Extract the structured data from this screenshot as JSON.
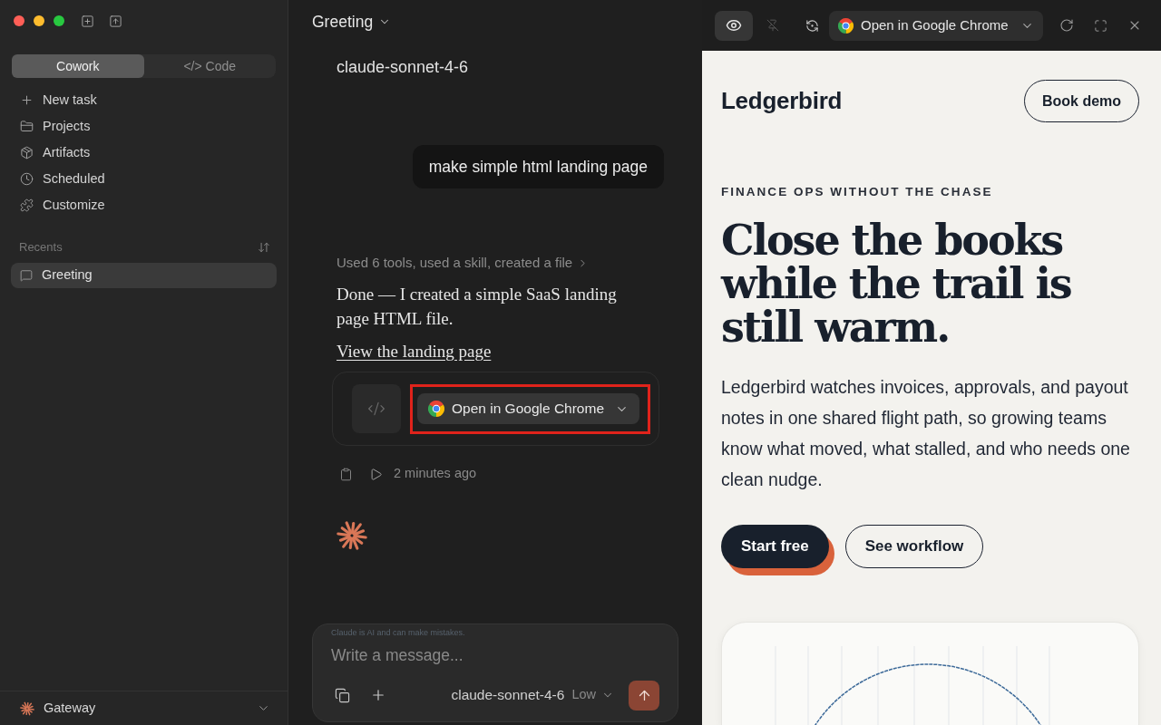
{
  "sidebar": {
    "mode_tabs": [
      {
        "label": "Cowork",
        "selected": true
      },
      {
        "label": "</> Code",
        "selected": false
      }
    ],
    "nav_items": [
      "New task",
      "Projects",
      "Artifacts",
      "Scheduled",
      "Customize"
    ],
    "recents_heading": "Recents",
    "recents": [
      {
        "label": "Greeting",
        "selected": true
      }
    ],
    "account": {
      "label": "Gateway"
    }
  },
  "chat": {
    "title": "Greeting",
    "model_label": "claude-sonnet-4-6",
    "user_message": "make simple html landing page",
    "activity_summary": "Used 6 tools, used a skill, created a file",
    "reply": "Done — I created a simple SaaS landing page HTML file.",
    "link": "View the landing page",
    "artifact": {
      "open_button": "Open in Google Chrome",
      "highlighted": true
    },
    "timestamp": "2 minutes ago"
  },
  "composer": {
    "disclaimer": "Claude is AI and can make mistakes.",
    "placeholder": "Write a message...",
    "model": "claude-sonnet-4-6",
    "effort": "Low"
  },
  "preview": {
    "toolbar": {
      "preview_selected": true,
      "open_button": "Open in Google Chrome"
    },
    "page": {
      "brand": "Ledgerbird",
      "header_button": "Book demo",
      "eyebrow": "FINANCE OPS WITHOUT THE CHASE",
      "headline": "Close the books while the trail is still warm.",
      "body": "Ledgerbird watches invoices, approvals, and payout notes in one shared flight path, so growing teams know what moved, what stalled, and who needs one clean nudge.",
      "buttons": [
        {
          "label": "Start free",
          "kind": "primary"
        },
        {
          "label": "See workflow",
          "kind": "secondary"
        }
      ]
    }
  }
}
